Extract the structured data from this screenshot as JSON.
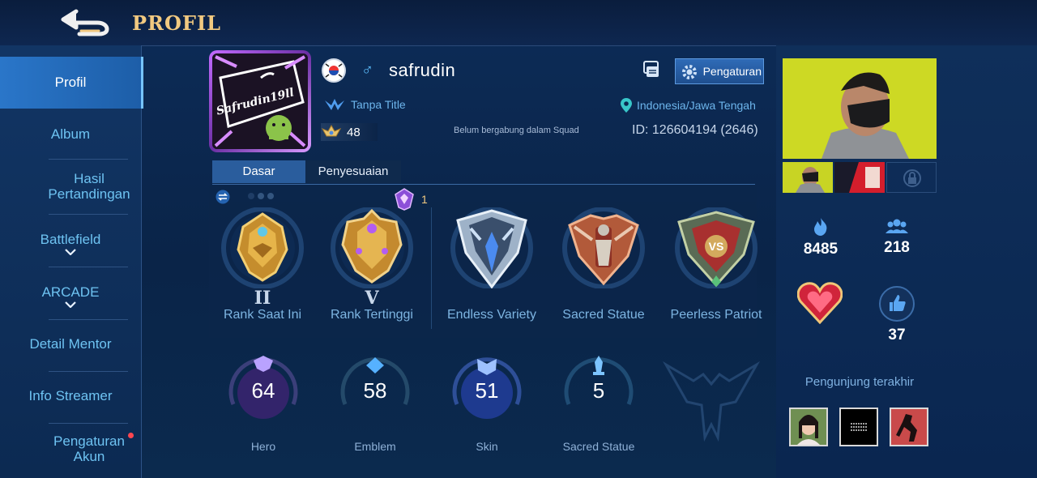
{
  "header": {
    "title": "PROFIL",
    "back_icon": "back-arrow-icon"
  },
  "sidebar": {
    "items": [
      {
        "label": "Profil",
        "active": true
      },
      {
        "label": "Album"
      },
      {
        "label": "Hasil Pertandingan"
      },
      {
        "label": "Battlefield",
        "expandable": true
      },
      {
        "label": "ARCADE",
        "expandable": true
      },
      {
        "label": "Detail Mentor"
      },
      {
        "label": "Info Streamer"
      },
      {
        "label": "Pengaturan Akun",
        "notification": true
      }
    ]
  },
  "profile": {
    "username": "safrudin",
    "gender_icon": "male-icon",
    "country_icon": "south-korea-flag-icon",
    "avatar_text": "Safrudin19ll",
    "title": "Tanpa Title",
    "location": "Indonesia/Jawa Tengah",
    "level": "48",
    "squad": "Belum bergabung dalam Squad",
    "id_text": "ID: 126604194 (2646)",
    "settings_label": "Pengaturan"
  },
  "tabs": [
    {
      "label": "Dasar",
      "active": true
    },
    {
      "label": "Penyesuaian",
      "active": false
    }
  ],
  "ranks": {
    "current": {
      "tier": "II",
      "label": "Rank Saat Ini"
    },
    "highest": {
      "tier": "V",
      "label": "Rank Tertinggi",
      "mythic_count": "1"
    }
  },
  "badges": [
    {
      "label": "Endless Variety"
    },
    {
      "label": "Sacred Statue"
    },
    {
      "label": "Peerless Patriot"
    }
  ],
  "stats": [
    {
      "value": "64",
      "label": "Hero",
      "color": "#b35df0"
    },
    {
      "value": "58",
      "label": "Emblem",
      "color": "#4fd1b0"
    },
    {
      "value": "51",
      "label": "Skin",
      "color": "#4f7bf0"
    },
    {
      "value": "5",
      "label": "Sacred Statue",
      "color": "#4aa8e8"
    }
  ],
  "right": {
    "popularity": "8485",
    "followers": "218",
    "likes": "37",
    "recent_visitors_label": "Pengunjung terakhir"
  },
  "colors": {
    "accent": "#f1c980",
    "link": "#6ec3f2",
    "panel": "#0b2750"
  }
}
